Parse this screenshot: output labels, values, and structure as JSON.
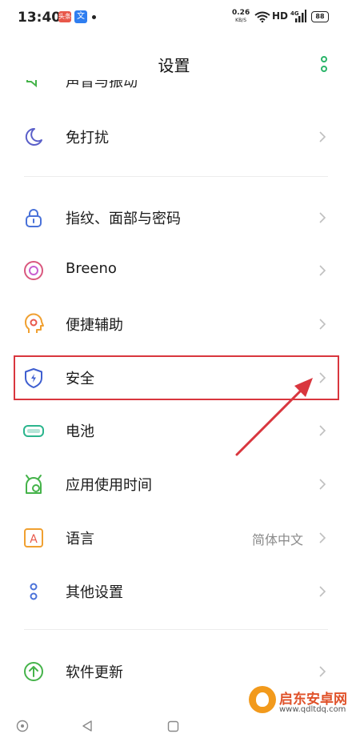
{
  "status_bar": {
    "time": "13:40",
    "app1_badge": "头条",
    "app2_badge": "文",
    "net_speed": "0.26",
    "net_unit": "KB/S",
    "hd": "HD",
    "signal_label": "4G",
    "battery": "88"
  },
  "header": {
    "title": "设置",
    "more_icon": "vertical-dots-icon"
  },
  "partial_item": {
    "label": "声音与振动"
  },
  "items": [
    {
      "label": "免打扰",
      "icon": "moon-icon",
      "color": "#5a5fc9"
    },
    {
      "label": "指纹、面部与密码",
      "icon": "lock-icon",
      "color": "#4a72d9"
    },
    {
      "label": "Breeno",
      "icon": "breeno-icon",
      "color": "#d9577e"
    },
    {
      "label": "便捷辅助",
      "icon": "assist-head-icon",
      "color": "#f0a030"
    },
    {
      "label": "安全",
      "icon": "shield-icon",
      "color": "#3f5fd0"
    },
    {
      "label": "电池",
      "icon": "battery-icon",
      "color": "#2bb58d"
    },
    {
      "label": "应用使用时间",
      "icon": "clock-icon",
      "color": "#45b34a"
    },
    {
      "label": "语言",
      "icon": "language-icon",
      "color": "#f0a030",
      "value": "简体中文"
    },
    {
      "label": "其他设置",
      "icon": "other-settings-icon",
      "color": "#4a72d9"
    },
    {
      "label": "软件更新",
      "icon": "update-icon",
      "color": "#45b34a"
    }
  ],
  "language_icon_glyph": "A",
  "accent_color": "#2bb56a",
  "annotation_color": "#d9363e",
  "watermark": {
    "title": "启东安卓网",
    "url": "www.qdltdq.com"
  }
}
